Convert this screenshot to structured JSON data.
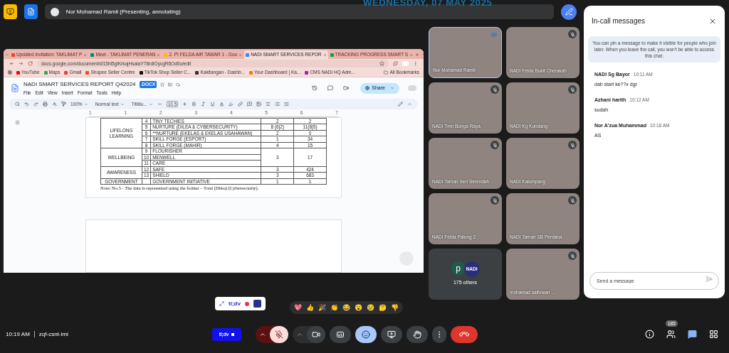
{
  "date_stamp": "WEDNESDAY, 07 MAY 2025",
  "presenter_bar": {
    "label": "Nor Mohamad Ramli (Presenting, annotating)"
  },
  "shared_screen": {
    "browser": {
      "tabs": [
        {
          "label": "Updated invitation: TAKLIMAT P",
          "kind": "mail",
          "selected": false
        },
        {
          "label": "Meet - TAKLIMAT PENERAN",
          "kind": "meet",
          "selected": false
        },
        {
          "label": "2. PI FELDA AIR TAWAR 1 - Goo",
          "kind": "drive",
          "selected": false
        },
        {
          "label": "NADI SMART SERVICES REPOR",
          "kind": "docs",
          "selected": true
        },
        {
          "label": "TRACKING PROGRESS SMART S",
          "kind": "sheets",
          "selected": false
        }
      ],
      "url": "docs.google.com/document/d/15hl5glKrkujHsaIaY78rdIOycgR6Od0o/edit",
      "bookmarks": [
        {
          "label": "YouTube",
          "color": "#ff0000"
        },
        {
          "label": "Maps",
          "color": "#34a853"
        },
        {
          "label": "Gmail",
          "color": "#ea4335"
        },
        {
          "label": "Shopee Seller Centre",
          "color": "#ee4d2d"
        },
        {
          "label": "TikTok Shop Seller C...",
          "color": "#111111"
        },
        {
          "label": "Kakitangan - Dashb...",
          "color": "#333333"
        },
        {
          "label": "Your Dashboard | Ka...",
          "color": "#f57c00"
        },
        {
          "label": "CMS NADI HQ Adm...",
          "color": "#9c27b0"
        }
      ],
      "bookmarks_folder": "All Bookmarks"
    },
    "doc": {
      "title": "NADI SMART SERVICES REPORT Q42024",
      "badge": ".DOCX",
      "menu": [
        "File",
        "Edit",
        "View",
        "Insert",
        "Format",
        "Tools",
        "Help"
      ],
      "share": "Share",
      "toolbar": {
        "zoom": "100%",
        "style": "Normal text",
        "font": "Titilliu...",
        "font_size": "10.5"
      },
      "ruler": [
        "1",
        "1",
        "2",
        "3",
        "4",
        "5",
        "6",
        "7"
      ],
      "table": [
        {
          "category": "LIFELONG LEARNING",
          "rows": [
            {
              "no": "4",
              "name": "TINY TECHIES",
              "values": [
                "2",
                "2"
              ]
            },
            {
              "no": "5",
              "name": "NURTURE (DILEA & CYBERSECURITY)",
              "values": [
                "8 (6|2)",
                "11(6|5)"
              ]
            },
            {
              "no": "6",
              "name": "**NURTURE (EKELAS & EKELAS USAHAWAN)",
              "values": [
                "2",
                "0"
              ]
            },
            {
              "no": "7",
              "name": "SKILL FORGE (ESPORT)",
              "values": [
                "1",
                "34"
              ]
            },
            {
              "no": "8",
              "name": "SKILL FORGE (MAHIR)",
              "values": [
                "4",
                "15"
              ]
            }
          ]
        },
        {
          "category": "WELLBEING",
          "values": [
            "3",
            "17"
          ],
          "rows": [
            {
              "no": "9",
              "name": "FLOURISHER"
            },
            {
              "no": "10",
              "name": "MENWELL"
            },
            {
              "no": "11",
              "name": "CARE"
            }
          ]
        },
        {
          "category": "AWARENESS",
          "rows": [
            {
              "no": "12",
              "name": "SAFE",
              "values": [
                "3",
                "424"
              ]
            },
            {
              "no": "13",
              "name": "SHIELD",
              "values": [
                "3",
                "683"
              ]
            }
          ]
        },
        {
          "category": "GOVERNMENT",
          "rows": [
            {
              "name": "GOVERNMENT INITIATIVE",
              "values": [
                "1",
                "1"
              ]
            }
          ]
        }
      ],
      "note": "Note: No.5 - The data is represented using the format – Total (Dilea) (Cybersecurity)."
    }
  },
  "tiles": [
    {
      "kind": "person",
      "name": "Nor Mohamad Ramli",
      "speaking": true,
      "muted": false
    },
    {
      "kind": "person",
      "name": "NADI Felda Bukit Cherakah",
      "speaking": false,
      "muted": true
    },
    {
      "kind": "person",
      "name": "NADI Tmn Bunga Raya",
      "speaking": false,
      "muted": true
    },
    {
      "kind": "person",
      "name": "NADI Kg Kundang",
      "speaking": false,
      "muted": true
    },
    {
      "kind": "person",
      "name": "NADI Taman Seri Serendah",
      "speaking": false,
      "muted": true
    },
    {
      "kind": "person",
      "name": "NADI Kalumpang",
      "speaking": false,
      "muted": true
    },
    {
      "kind": "person",
      "name": "NADI Felda Palong 2",
      "speaking": false,
      "muted": true
    },
    {
      "kind": "person",
      "name": "NADI Taman SB Perdana",
      "speaking": false,
      "muted": true
    },
    {
      "kind": "others",
      "label": "175 others",
      "avatar_letter": "p",
      "logo": "NADI"
    },
    {
      "kind": "person",
      "name": "mohamad saifuwan ...",
      "speaking": false,
      "muted": true
    }
  ],
  "chat": {
    "title": "In-call messages",
    "info": "You can pin a message to make it visible for people who join later. When you leave the call, you won't be able to access this chat.",
    "messages": [
      {
        "sender": "NADI Sg Bayor",
        "time": "10:11 AM",
        "text": "dah start ke??x dgr"
      },
      {
        "sender": "Azhani harith",
        "time": "10:12 AM",
        "text": "sudah"
      },
      {
        "sender": "Nor A'zua Muhammad",
        "time": "10:18 AM",
        "text": "AS"
      }
    ],
    "input_placeholder": "Send a message"
  },
  "bottom": {
    "time": "10:19 AM",
    "meeting_code": "zqf-csnt-imi",
    "tldv_widget": {
      "label": "tl;dv",
      "recording": true
    },
    "tldv_button": "tl;dv",
    "reactions": [
      "💖",
      "👍",
      "🎉",
      "👏",
      "😂",
      "😮",
      "😢",
      "🤔",
      "👎"
    ],
    "controls": [
      {
        "kind": "mic",
        "on": false
      },
      {
        "kind": "camera",
        "on": true
      },
      {
        "kind": "captions",
        "on": false
      },
      {
        "kind": "reactions",
        "on": true
      },
      {
        "kind": "present",
        "on": false
      },
      {
        "kind": "hand",
        "on": false
      },
      {
        "kind": "more"
      },
      {
        "kind": "end"
      }
    ],
    "side": [
      {
        "kind": "info",
        "selected": false
      },
      {
        "kind": "people",
        "selected": false,
        "badge": "185"
      },
      {
        "kind": "chat",
        "selected": true
      },
      {
        "kind": "activities",
        "selected": false
      }
    ]
  }
}
